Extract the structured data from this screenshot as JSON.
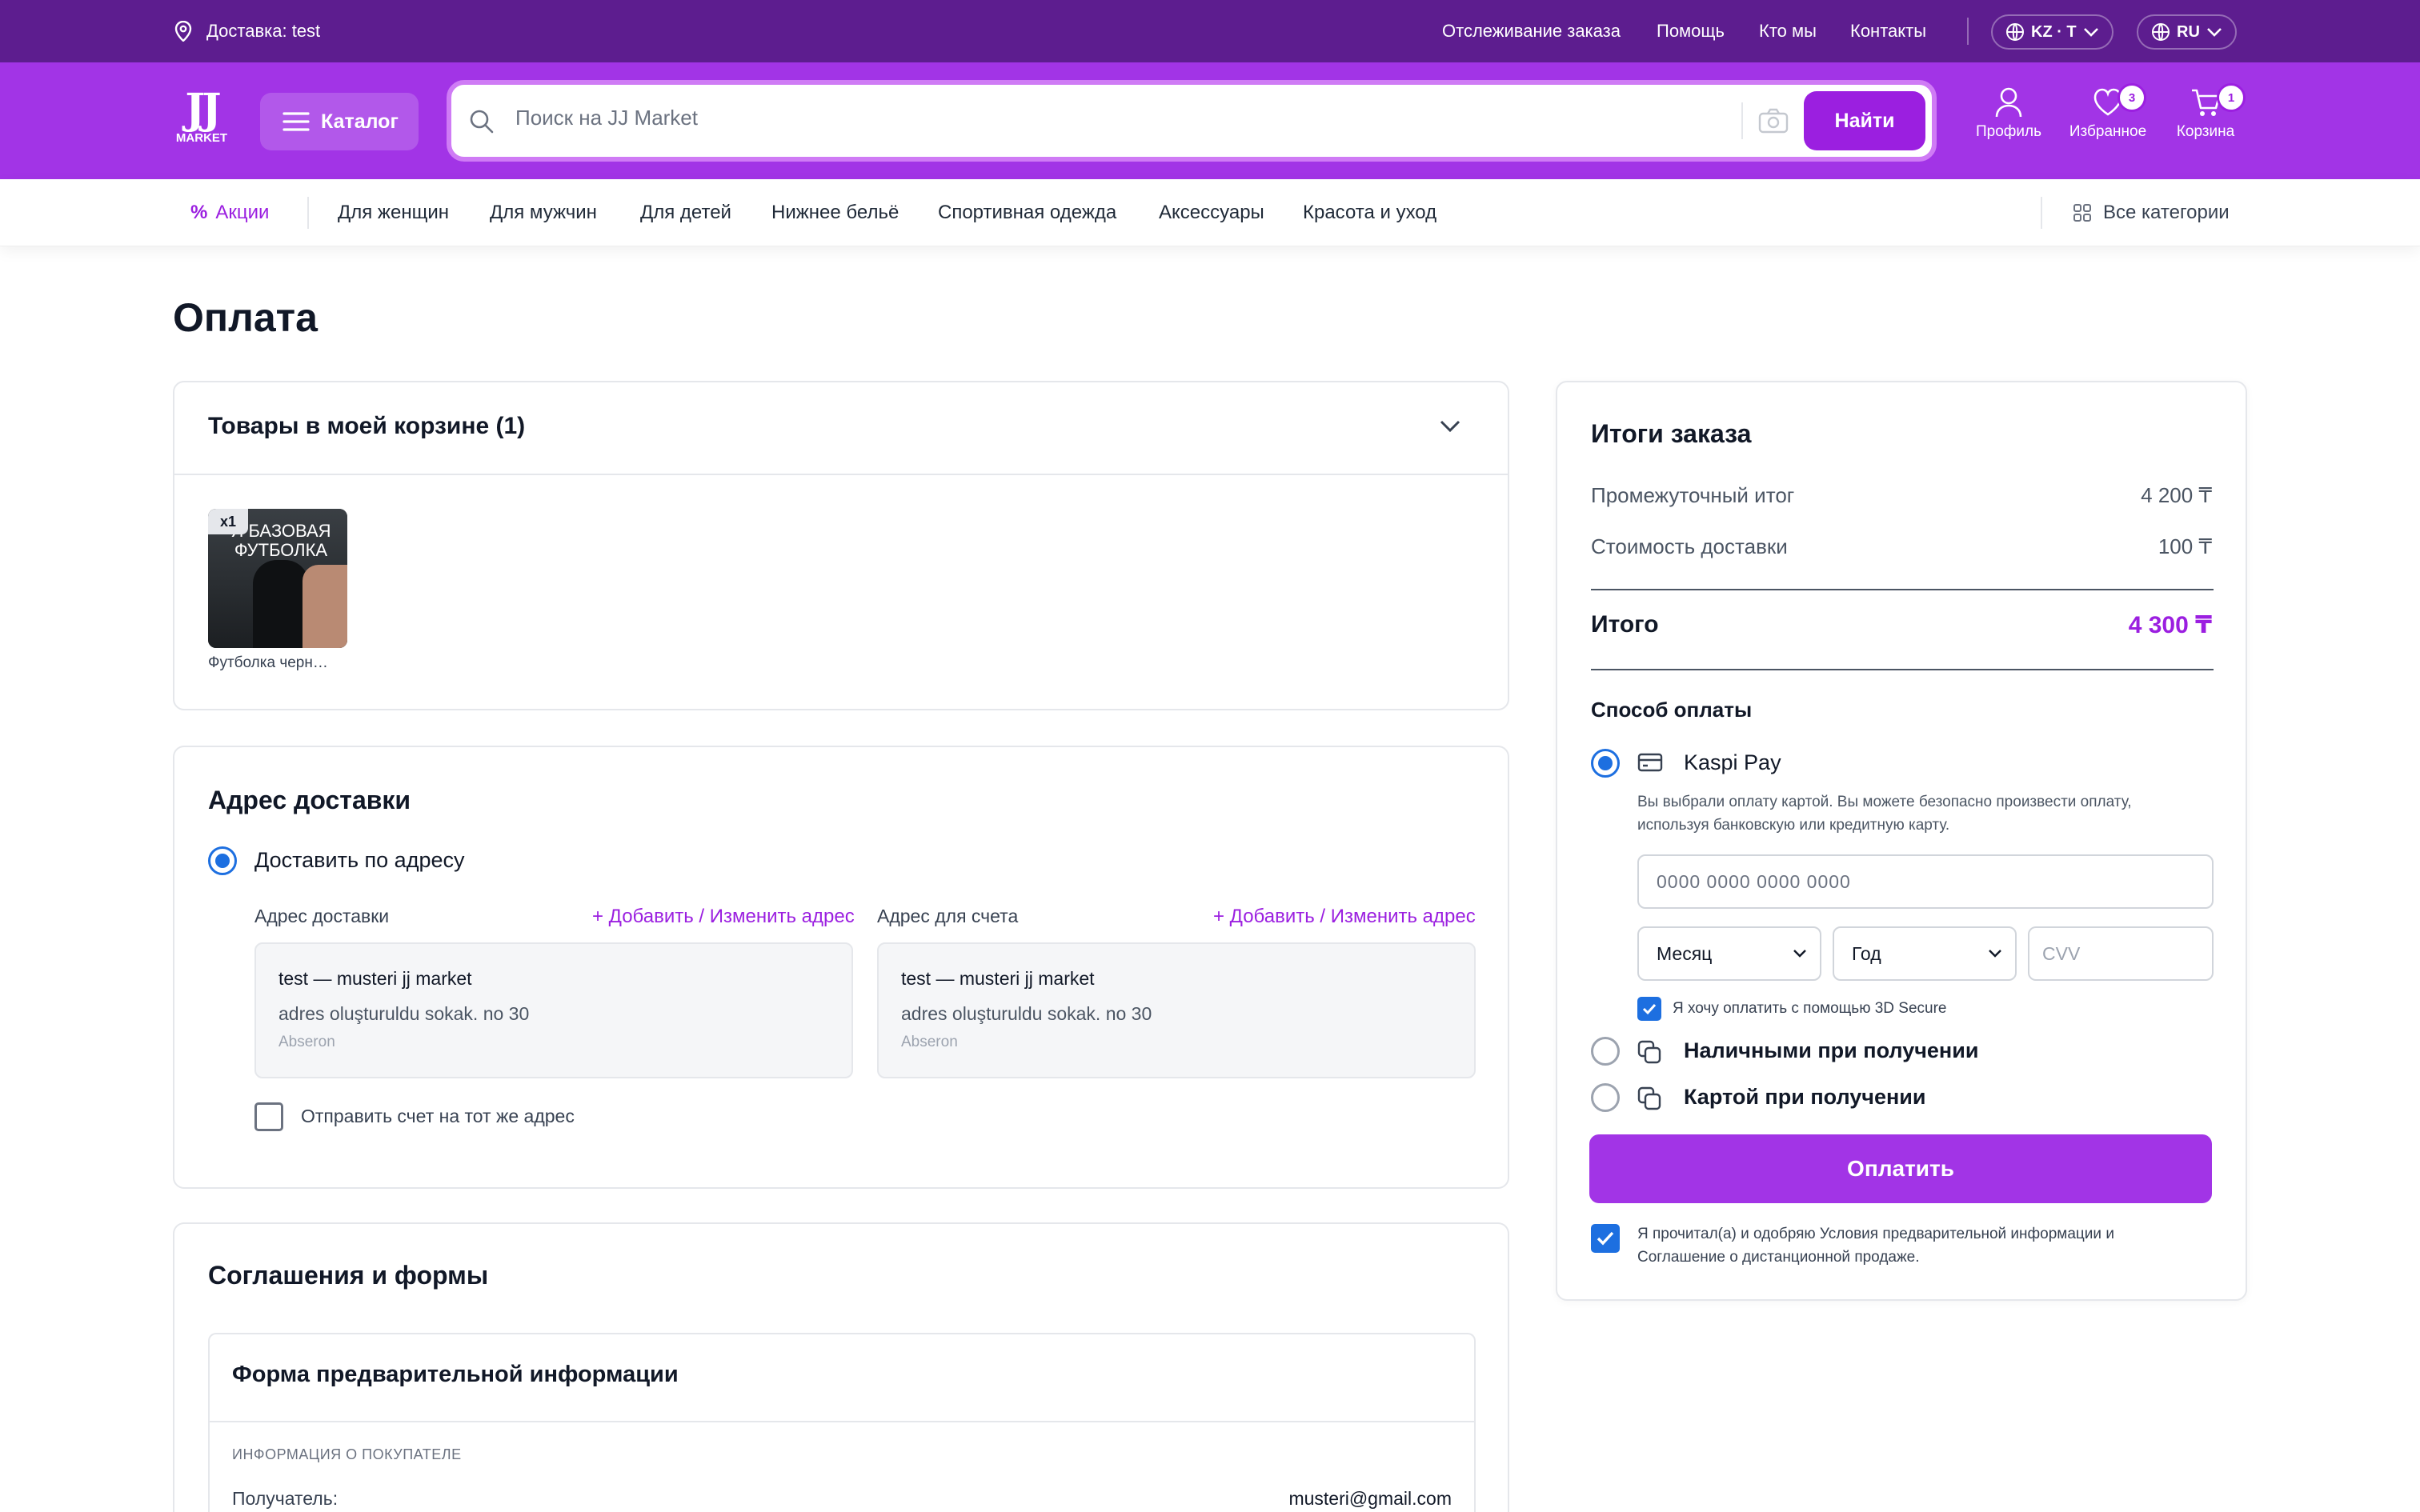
{
  "topbar": {
    "delivery": "Доставка: test",
    "links": [
      "Отслеживание заказа",
      "Помощь",
      "Кто мы",
      "Контакты"
    ],
    "region": "KZ · T",
    "language": "RU"
  },
  "header": {
    "logo_letters": "JJ",
    "logo_word": "MARKET",
    "catalog_label": "Каталог",
    "search_placeholder": "Поиск на JJ Market",
    "search_button": "Найти",
    "profile_label": "Профиль",
    "favorites_label": "Избранное",
    "favorites_count": "3",
    "cart_label": "Корзина",
    "cart_count": "1"
  },
  "nav": {
    "sale": "Акции",
    "items": [
      "Для женщин",
      "Для мужчин",
      "Для детей",
      "Нижнее бельё",
      "Спортивная одежда",
      "Аксессуары",
      "Красота и уход"
    ],
    "all_categories": "Все категории"
  },
  "page": {
    "title": "Оплата"
  },
  "cart_section": {
    "title": "Товары в моей корзине (1)",
    "product": {
      "quantity": "x1",
      "image_text_line1": "Я БАЗОВАЯ",
      "image_text_line2": "ФУТБОЛКА",
      "name": "Футболка черн…"
    }
  },
  "delivery_section": {
    "title": "Адрес доставки",
    "option_label": "Доставить по адресу",
    "shipping": {
      "heading": "Адрес доставки",
      "edit_link": "+ Добавить / Изменить адрес",
      "name": "test — musteri jj market",
      "street": "adres oluşturuldu sokak. no 30",
      "city": "Abseron"
    },
    "billing": {
      "heading": "Адрес для счета",
      "edit_link": "+ Добавить / Изменить адрес",
      "name": "test — musteri jj market",
      "street": "adres oluşturuldu sokak. no 30",
      "city": "Abseron"
    },
    "same_address_label": "Отправить счет на тот же адрес"
  },
  "agreements_section": {
    "title": "Соглашения и формы",
    "form_title": "Форма предварительной информации",
    "buyer_info_heading": "ИНФОРМАЦИЯ О ПОКУПАТЕЛЕ",
    "recipient_label": "Получатель:",
    "recipient_email": "musteri@gmail.com"
  },
  "summary": {
    "title": "Итоги заказа",
    "subtotal_label": "Промежуточный итог",
    "subtotal_value": "4 200 ₸",
    "shipping_label": "Стоимость доставки",
    "shipping_value": "100 ₸",
    "total_label": "Итого",
    "total_value": "4 300 ₸",
    "payment_heading": "Способ оплаты",
    "kaspi_label": "Kaspi Pay",
    "kaspi_note_line1": "Вы выбрали оплату картой. Вы можете безопасно произвести оплату,",
    "kaspi_note_line2": "используя банковскую или кредитную карту.",
    "card_placeholder": "0000 0000 0000 0000",
    "month_label": "Месяц",
    "year_label": "Год",
    "cvv_placeholder": "CVV",
    "secure_label": "Я хочу оплатить с помощью 3D Secure",
    "cash_label": "Наличными при получении",
    "card_on_delivery_label": "Картой при получении",
    "pay_button": "Оплатить",
    "terms_line1": "Я прочитал(а) и одобряю Условия предварительной информации и",
    "terms_line2": "Соглашение о дистанционной продаже."
  },
  "colors": {
    "topbar": "#5d1d8f",
    "header": "#a234e6",
    "accent": "#9b1fe0",
    "radio_blue": "#1d6fe0"
  }
}
